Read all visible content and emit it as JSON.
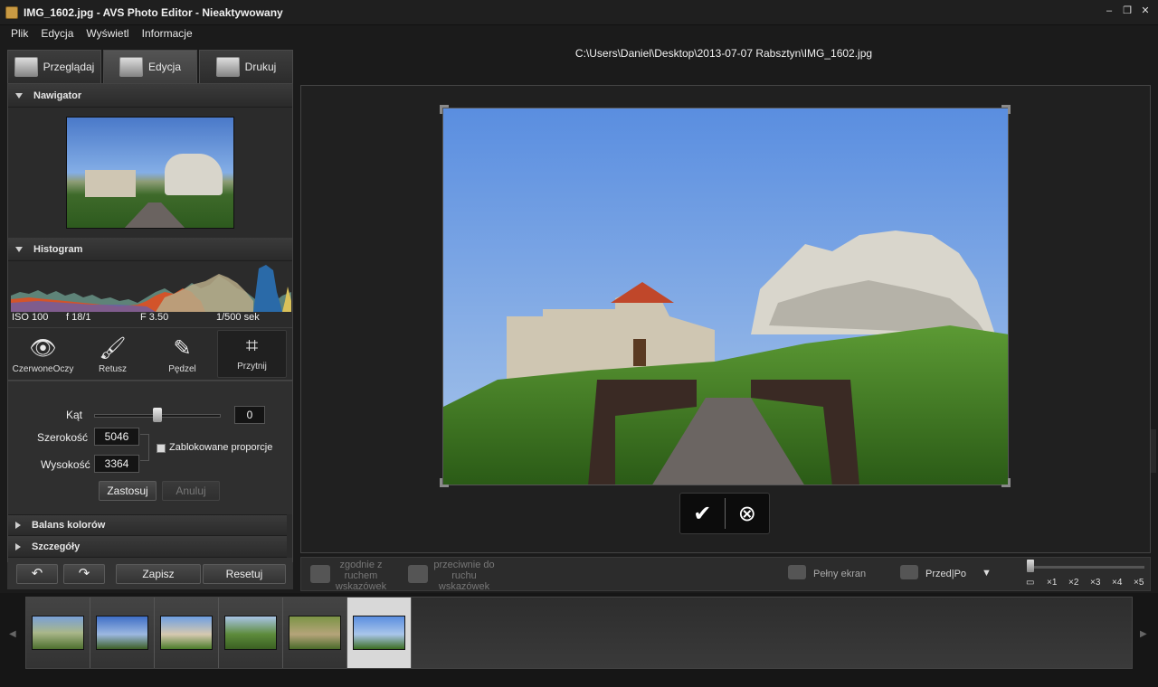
{
  "window": {
    "title": "IMG_1602.jpg  -  AVS Photo Editor - Nieaktywowany"
  },
  "menu": [
    "Plik",
    "Edycja",
    "Wyświetl",
    "Informacje"
  ],
  "file_path": "C:\\Users\\Daniel\\Desktop\\2013-07-07 Rabsztyn\\IMG_1602.jpg",
  "tabs": [
    {
      "label": "Przeglądaj",
      "icon": "folder-icon"
    },
    {
      "label": "Edycja",
      "icon": "edit-icon"
    },
    {
      "label": "Drukuj",
      "icon": "printer-icon"
    }
  ],
  "active_tab": "Edycja",
  "panels": {
    "navigator_title": "Nawigator",
    "histogram_title": "Histogram",
    "histogram_info": {
      "iso": "ISO 100",
      "fnum": "f 18/1",
      "aperture": "F 3.50",
      "shutter": "1/500 sek"
    },
    "color_balance": "Balans kolorów",
    "details": "Szczegóły"
  },
  "tools": [
    {
      "label": "CzerwoneOczy",
      "icon": "eye-icon"
    },
    {
      "label": "Retusz",
      "icon": "retouch-brush-icon"
    },
    {
      "label": "Pędzel",
      "icon": "paintbrush-icon"
    },
    {
      "label": "Przytnij",
      "icon": "crop-icon"
    }
  ],
  "active_tool": "Przytnij",
  "crop": {
    "angle_label": "Kąt",
    "angle_value": "0",
    "width_label": "Szerokość",
    "width_value": "5046",
    "height_label": "Wysokość",
    "height_value": "3364",
    "lock_label": "Zablokowane proporcje",
    "lock_checked": false,
    "apply": "Zastosuj",
    "cancel": "Anuluj"
  },
  "bottom_buttons": {
    "save": "Zapisz",
    "reset": "Resetuj"
  },
  "viewer_toolbar": {
    "rotate_cw": "zgodnie z ruchem wskazówek",
    "rotate_ccw": "przeciwnie do ruchu wskazówek",
    "fullscreen": "Pełny ekran",
    "before_after": "Przed|Po",
    "zoom_levels": [
      "×1",
      "×2",
      "×3",
      "×4",
      "×5"
    ]
  },
  "filmstrip_count": 6,
  "selected_thumb_index": 6
}
